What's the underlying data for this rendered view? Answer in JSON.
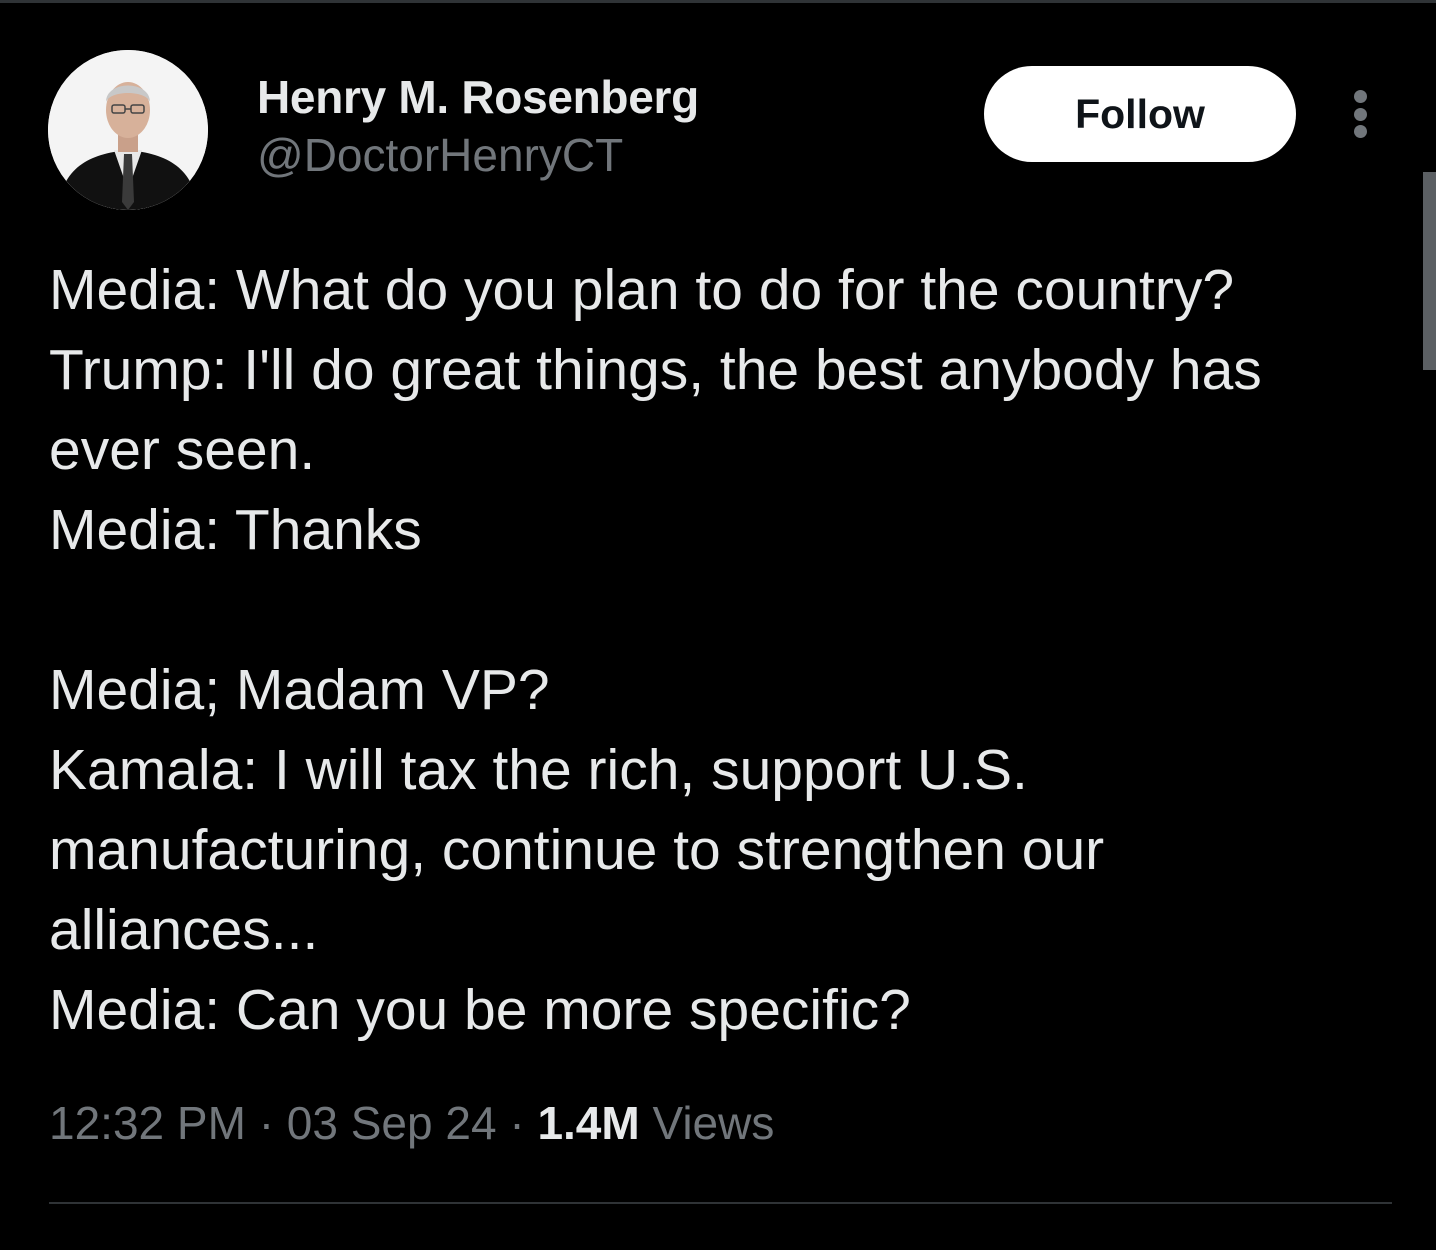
{
  "author": {
    "name": "Henry M. Rosenberg",
    "handle": "@DoctorHenryCT",
    "avatar_icon": "profile-photo"
  },
  "actions": {
    "follow_label": "Follow",
    "more_icon": "more-vertical-icon"
  },
  "tweet": {
    "lines": [
      "Media: What do you plan to do for the country?",
      "Trump: I'll do great things, the best anybody has",
      "ever seen.",
      "Media: Thanks",
      "",
      "Media; Madam VP?",
      "Kamala: I will tax the rich, support U.S.",
      "manufacturing, continue to strengthen our",
      "alliances...",
      "Media: Can you be more specific?"
    ]
  },
  "meta": {
    "time": "12:32 PM",
    "date": "03 Sep 24",
    "separator": "·",
    "views_count": "1.4M",
    "views_label": "Views"
  },
  "colors": {
    "background": "#000000",
    "primary_text": "#e7e9ea",
    "secondary_text": "#71767b",
    "follow_button_bg": "#ffffff",
    "follow_button_text": "#0f1419",
    "divider": "#2f3336"
  }
}
